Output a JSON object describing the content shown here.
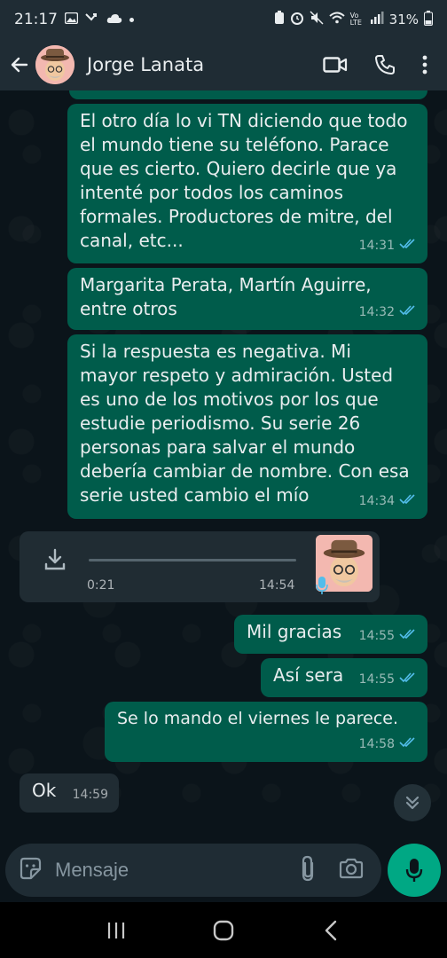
{
  "status_bar": {
    "time": "21:17",
    "battery": "31%",
    "network": "Vo LTE"
  },
  "header": {
    "contact_name": "Jorge Lanata"
  },
  "messages": [
    {
      "direction": "out",
      "text_lines": [
        "El otro día lo vi TN diciendo que todo",
        "el mundo tiene su teléfono. Parace",
        "que es cierto. Quiero decirle que ya",
        "intenté por todos los caminos",
        "formales. Productores de mitre, del",
        "canal, etc..."
      ],
      "time": "14:31",
      "status": "read"
    },
    {
      "direction": "out",
      "text_lines": [
        "Margarita Perata, Martín Aguirre,",
        "entre otros"
      ],
      "time": "14:32",
      "status": "read"
    },
    {
      "direction": "out",
      "text_lines": [
        "Si la respuesta es negativa. Mi",
        "mayor respeto y admiración. Usted",
        "es uno de los motivos por los que",
        "estudie periodismo. Su serie 26",
        "personas para salvar el mundo",
        "debería cambiar de nombre. Con esa",
        "serie usted cambio el mío"
      ],
      "time": "14:34",
      "status": "read"
    },
    {
      "direction": "in",
      "type": "audio",
      "duration": "0:21",
      "time": "14:54",
      "progress": 0
    },
    {
      "direction": "out",
      "text_lines": [
        "Mil gracias"
      ],
      "time": "14:55",
      "status": "read"
    },
    {
      "direction": "out",
      "text_lines": [
        "Así sera"
      ],
      "time": "14:55",
      "status": "read"
    },
    {
      "direction": "out",
      "text_lines": [
        "Se lo mando el viernes le parece."
      ],
      "time": "14:58",
      "status": "read"
    },
    {
      "direction": "in",
      "text_lines": [
        "Ok"
      ],
      "time": "14:59"
    }
  ],
  "input": {
    "placeholder": "Mensaje",
    "value": ""
  },
  "colors": {
    "background": "#0b141a",
    "header": "#1f2c34",
    "outgoing_bubble": "#005c4b",
    "incoming_bubble": "#202c33",
    "accent": "#00a884",
    "read_ticks": "#53bdeb"
  },
  "icons": {
    "header": [
      "back-arrow-icon",
      "video-call-icon",
      "phone-icon",
      "more-vert-icon"
    ],
    "input": [
      "sticker-icon",
      "attach-icon",
      "camera-icon",
      "mic-icon"
    ],
    "nav": [
      "recents-icon",
      "home-icon",
      "back-icon"
    ]
  }
}
